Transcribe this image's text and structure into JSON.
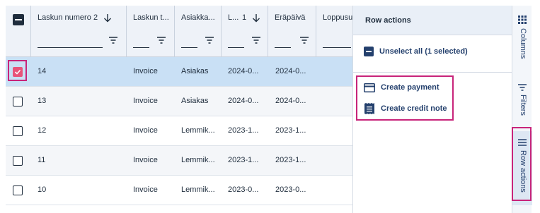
{
  "header": {
    "columns": [
      "Laskun numero",
      "Laskun t...",
      "Asiakka...",
      "L...",
      "Eräpäivä",
      "Loppusu..."
    ],
    "sort1_index": "2",
    "sort2_index": "1"
  },
  "rows": [
    {
      "num": "14",
      "type": "Invoice",
      "customer": "Asiakas",
      "d1": "2024-0...",
      "d2": "2024-0...",
      "selected": true
    },
    {
      "num": "13",
      "type": "Invoice",
      "customer": "Asiakas",
      "d1": "2024-0...",
      "d2": "2024-0...",
      "selected": false
    },
    {
      "num": "12",
      "type": "Invoice",
      "customer": "Lemmik...",
      "d1": "2023-1...",
      "d2": "2023-1...",
      "selected": false
    },
    {
      "num": "11",
      "type": "Invoice",
      "customer": "Lemmik...",
      "d1": "2023-1...",
      "d2": "2023-1...",
      "selected": false
    },
    {
      "num": "10",
      "type": "Invoice",
      "customer": "Lemmik...",
      "d1": "2023-0...",
      "d2": "2023-0...",
      "selected": false
    }
  ],
  "panel": {
    "title": "Row actions",
    "unselect_label": "Unselect all (1 selected)",
    "create_payment_label": "Create payment",
    "create_credit_note_label": "Create credit note"
  },
  "rail": {
    "columns_label": "Columns",
    "filters_label": "Filters",
    "row_actions_label": "Row actions"
  },
  "colors": {
    "accent": "#24406d",
    "highlight": "#c8247a",
    "selected_row": "#c9e0f5",
    "checkbox_checked": "#e8537a"
  }
}
